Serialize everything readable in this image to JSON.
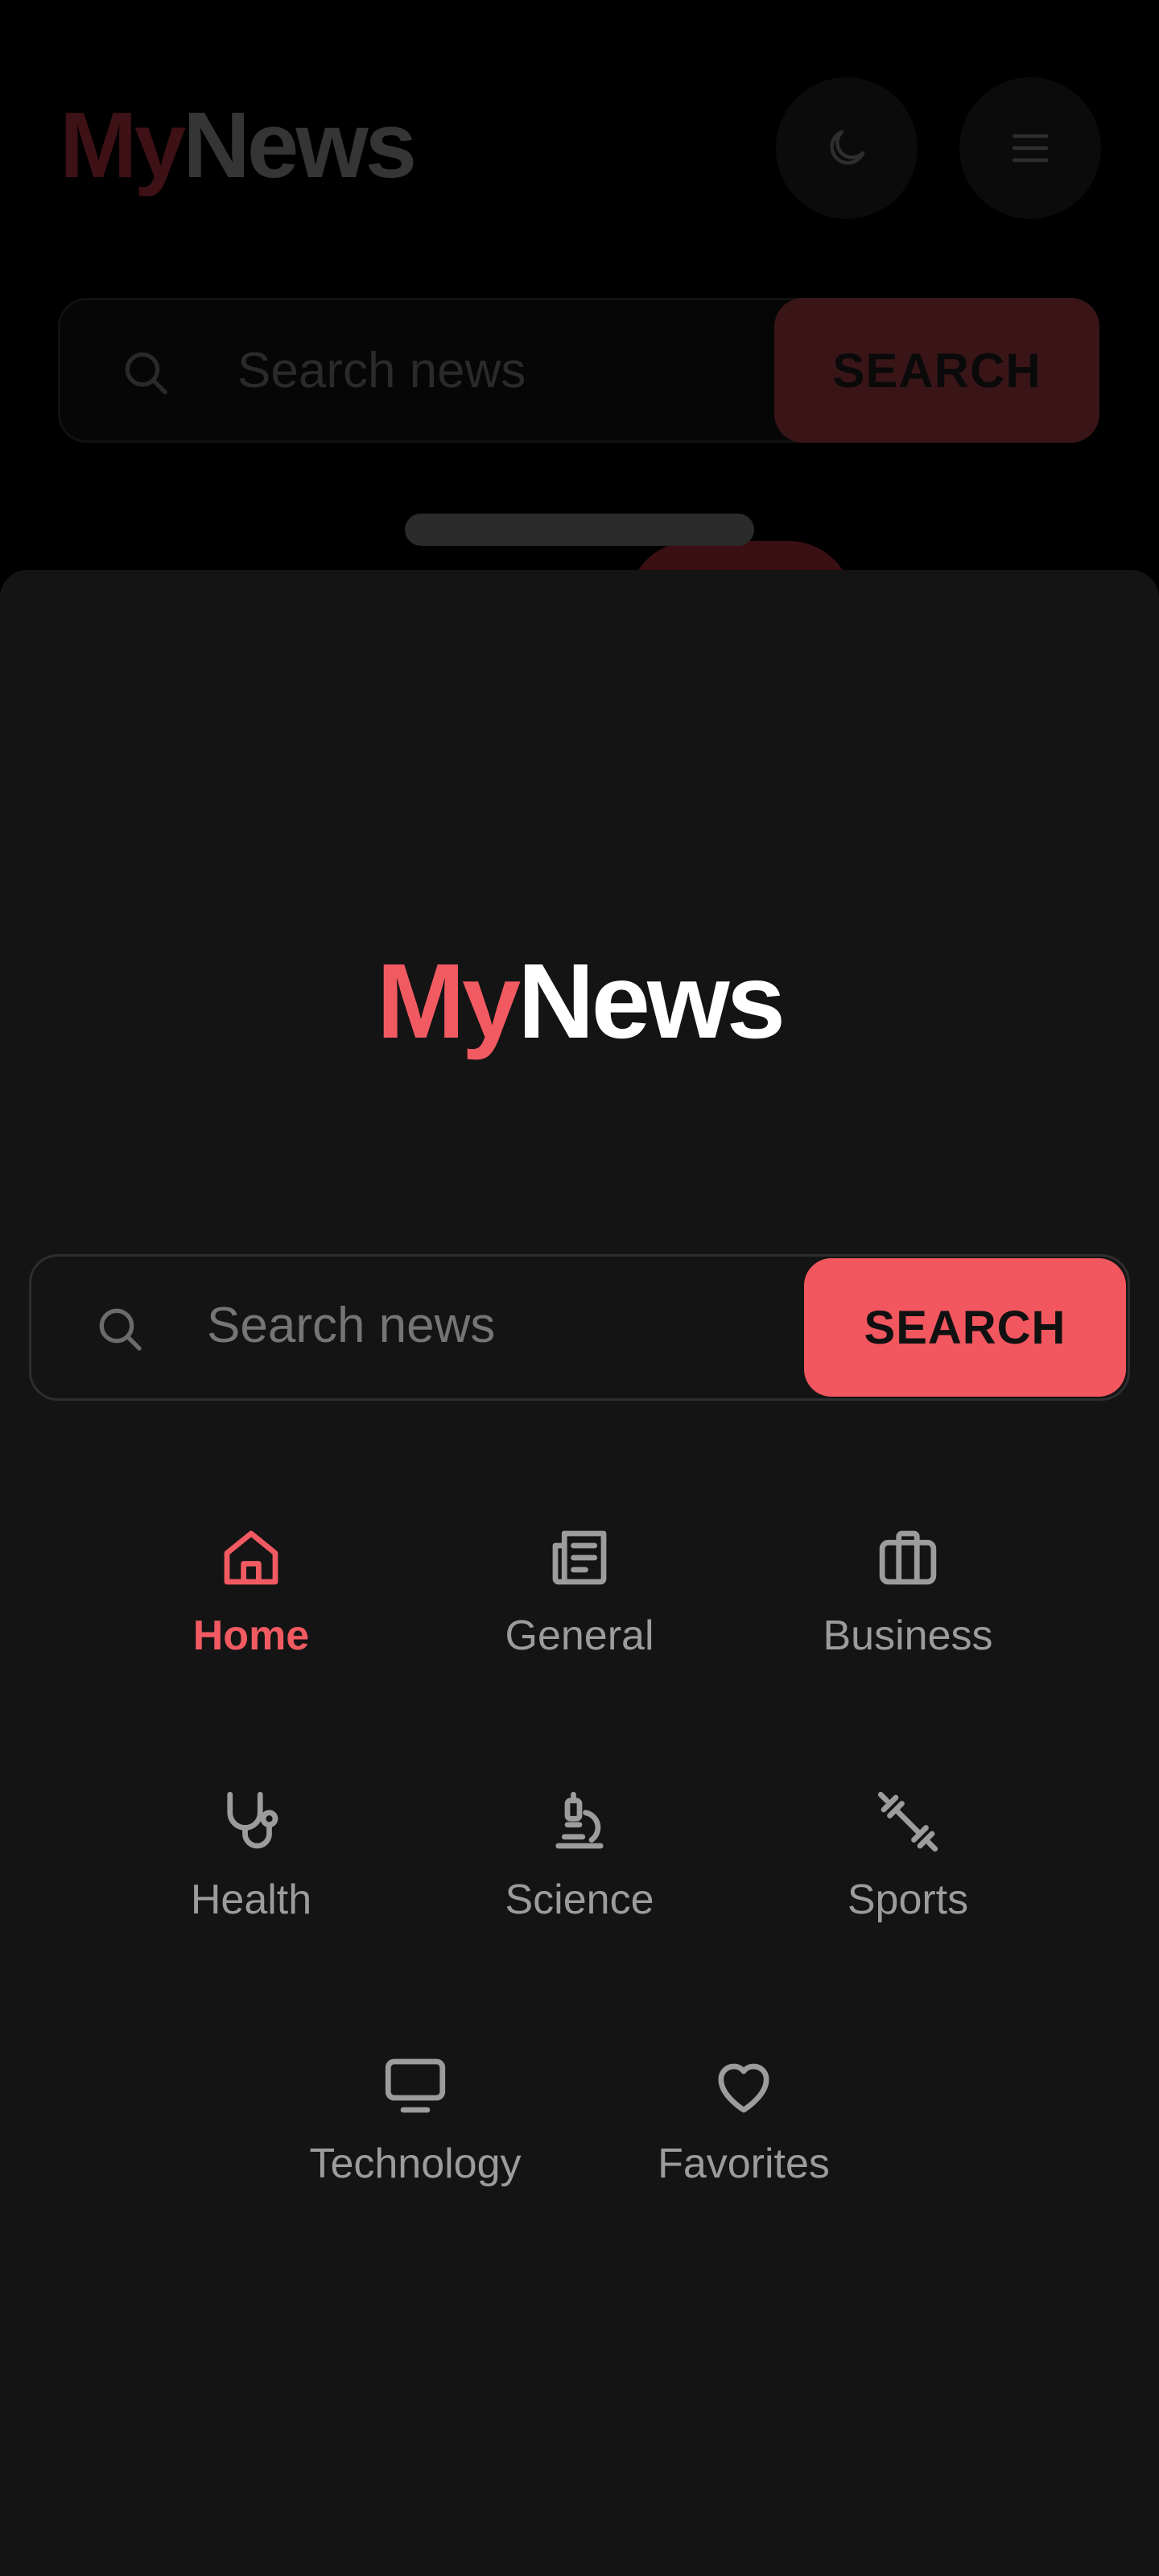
{
  "background": {
    "logo": {
      "part1": "My",
      "part2": "News"
    },
    "search": {
      "placeholder": "Search news",
      "button_label": "SEARCH"
    }
  },
  "sheet": {
    "logo": {
      "part1": "My",
      "part2": "News"
    },
    "search": {
      "placeholder": "Search news",
      "button_label": "SEARCH"
    },
    "nav_items": [
      {
        "label": "Home",
        "icon": "home-icon",
        "active": true
      },
      {
        "label": "General",
        "icon": "newspaper-icon",
        "active": false
      },
      {
        "label": "Business",
        "icon": "briefcase-icon",
        "active": false
      },
      {
        "label": "Health",
        "icon": "stethoscope-icon",
        "active": false
      },
      {
        "label": "Science",
        "icon": "microscope-icon",
        "active": false
      },
      {
        "label": "Sports",
        "icon": "dumbbell-icon",
        "active": false
      },
      {
        "label": "Technology",
        "icon": "monitor-icon",
        "active": false
      },
      {
        "label": "Favorites",
        "icon": "heart-icon",
        "active": false
      }
    ]
  },
  "colors": {
    "accent": "#f25a62",
    "sheet_background": "#141414",
    "inactive_text": "#9c9c9c"
  }
}
